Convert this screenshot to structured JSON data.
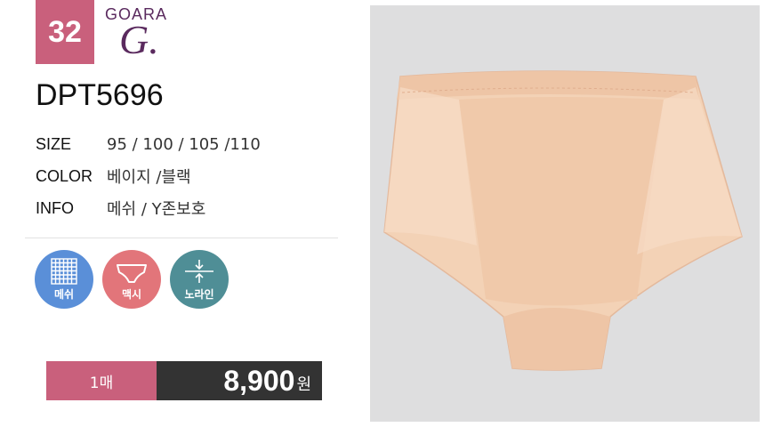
{
  "badge": {
    "number": "32"
  },
  "brand": {
    "name": "GOARA",
    "mark": "G."
  },
  "product": {
    "code": "DPT5696",
    "specs": [
      {
        "label": "SIZE",
        "value": "95 / 100 / 105 /110"
      },
      {
        "label": "COLOR",
        "value": "베이지 /블랙"
      },
      {
        "label": "INFO",
        "value": "메쉬 / Y존보호"
      }
    ]
  },
  "features": [
    {
      "label": "메쉬",
      "icon": "mesh-grid-icon",
      "color": "#5a8fd8"
    },
    {
      "label": "맥시",
      "icon": "maxi-brief-icon",
      "color": "#e2757a"
    },
    {
      "label": "노라인",
      "icon": "no-line-icon",
      "color": "#4f8e96"
    }
  ],
  "price": {
    "quantity": "1매",
    "amount": "8,900",
    "unit": "원"
  },
  "colors": {
    "accent": "#c9607c",
    "dark": "#333333",
    "product": "#f3d2b6"
  }
}
